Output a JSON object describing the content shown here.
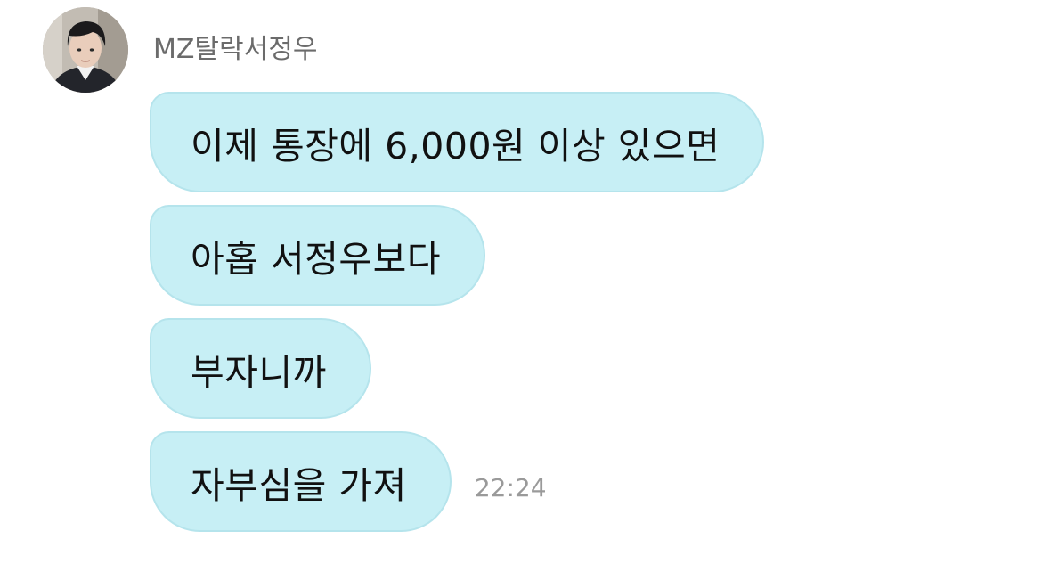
{
  "chat": {
    "sender": {
      "name": "MZ탈락서정우",
      "avatar_icon": "profile-photo"
    },
    "messages": [
      {
        "text": "이제 통장에 6,000원 이상 있으면"
      },
      {
        "text": "아홉 서정우보다"
      },
      {
        "text": "부자니까"
      },
      {
        "text": "자부심을 가져",
        "time": "22:24"
      }
    ],
    "colors": {
      "bubble_bg": "#c7eff5",
      "bubble_border": "#b5e4ec",
      "time_text": "#9a9a9a",
      "sender_text": "#6b6b6b"
    }
  }
}
